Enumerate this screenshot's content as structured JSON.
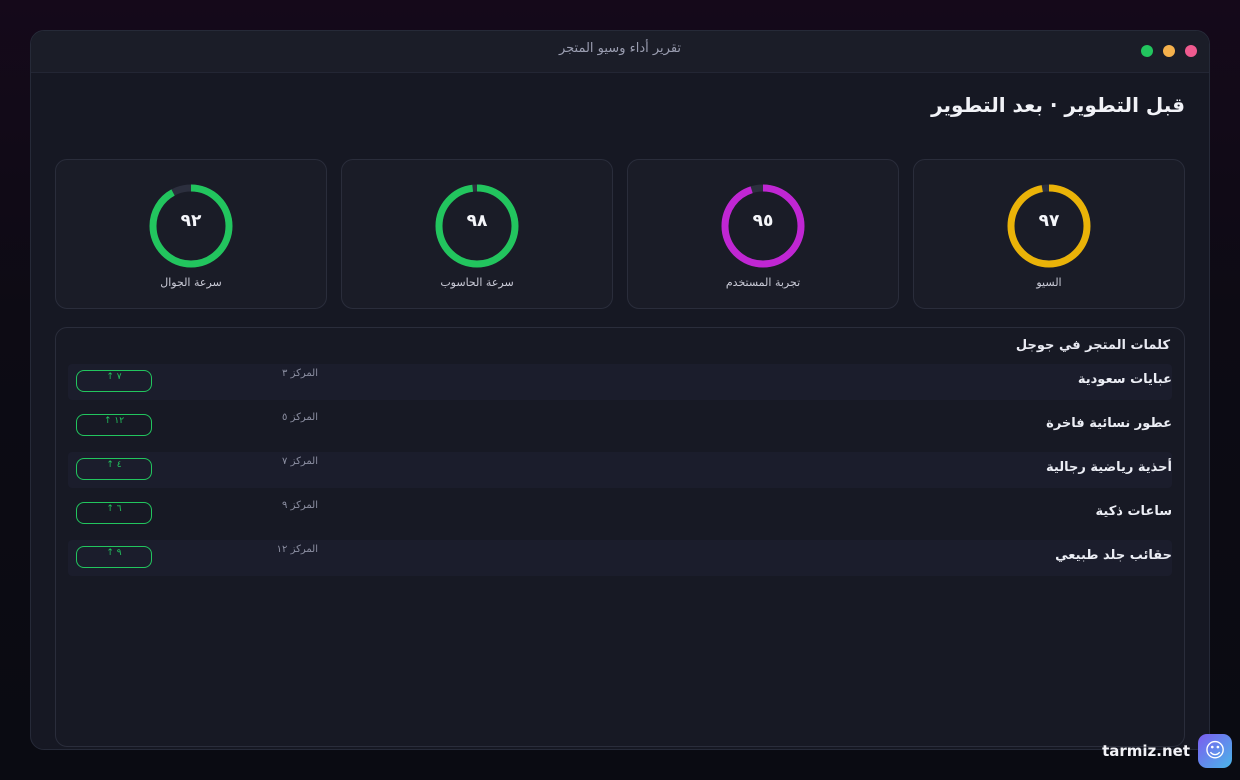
{
  "window": {
    "title": "تقرير أداء وسيو المتجر"
  },
  "traffic_lights": {
    "close": "#ef5a8f",
    "minimize": "#f5b14c",
    "maximize": "#22c55e"
  },
  "page": {
    "heading": "قبل التطوير · بعد التطوير"
  },
  "cards": [
    {
      "label": "السيو",
      "value": "٩٧",
      "percent": 97,
      "color": "#eab308"
    },
    {
      "label": "تجربة المستخدم",
      "value": "٩٥",
      "percent": 95,
      "color": "#c026d3"
    },
    {
      "label": "سرعة الحاسوب",
      "value": "٩٨",
      "percent": 98,
      "color": "#22c55e"
    },
    {
      "label": "سرعة الجوال",
      "value": "٩٢",
      "percent": 92,
      "color": "#22c55e"
    }
  ],
  "keywords": {
    "title": "كلمات المتجر في جوجل",
    "rows": [
      {
        "name": "عبايات سعودية",
        "position": "المركز ٣",
        "change": "٧ ↑"
      },
      {
        "name": "عطور نسائية فاخرة",
        "position": "المركز ٥",
        "change": "١٢ ↑"
      },
      {
        "name": "أحذية رياضية رجالية",
        "position": "المركز ٧",
        "change": "٤ ↑"
      },
      {
        "name": "ساعات ذكية",
        "position": "المركز ٩",
        "change": "٦ ↑"
      },
      {
        "name": "حقائب جلد طبيعي",
        "position": "المركز ١٢",
        "change": "٩ ↑"
      }
    ]
  },
  "brand": {
    "text": "tarmiz.net",
    "icon": "smile-icon"
  }
}
